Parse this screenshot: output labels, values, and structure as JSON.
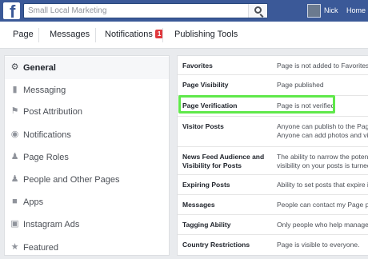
{
  "topbar": {
    "search_value": "Small Local Marketing",
    "user_name": "Nick",
    "home_label": "Home",
    "accent": "#3b5998"
  },
  "pagenav": {
    "items": [
      {
        "label": "Page"
      },
      {
        "label": "Messages"
      },
      {
        "label": "Notifications",
        "badge": "1"
      },
      {
        "label": "Publishing Tools"
      }
    ]
  },
  "sidebar": {
    "items": [
      {
        "label": "General",
        "icon": "gear-icon"
      },
      {
        "label": "Messaging",
        "icon": "chat-bubbles-icon"
      },
      {
        "label": "Post Attribution",
        "icon": "flag-icon"
      },
      {
        "label": "Notifications",
        "icon": "globe-icon"
      },
      {
        "label": "Page Roles",
        "icon": "person-icon"
      },
      {
        "label": "People and Other Pages",
        "icon": "people-icon"
      },
      {
        "label": "Apps",
        "icon": "cube-icon"
      },
      {
        "label": "Instagram Ads",
        "icon": "instagram-icon"
      },
      {
        "label": "Featured",
        "icon": "star-icon"
      }
    ]
  },
  "settings": {
    "rows": [
      {
        "title": "Favorites",
        "value": "Page is not added to Favorites"
      },
      {
        "title": "Page Visibility",
        "value": "Page published"
      },
      {
        "title": "Page Verification",
        "value": "Page is not verified"
      },
      {
        "title": "Visitor Posts",
        "value": "Anyone can publish to the Page",
        "value2": "Anyone can add photos and video"
      },
      {
        "title": "News Feed Audience and Visibility for Posts",
        "value": "The ability to narrow the potential",
        "value2": "visibility on your posts is turned"
      },
      {
        "title": "Expiring Posts",
        "value": "Ability to set posts that expire is"
      },
      {
        "title": "Messages",
        "value": "People can contact my Page priv"
      },
      {
        "title": "Tagging Ability",
        "value": "Only people who help manage my"
      },
      {
        "title": "Country Restrictions",
        "value": "Page is visible to everyone."
      }
    ]
  },
  "highlight_color": "#5fe84a"
}
